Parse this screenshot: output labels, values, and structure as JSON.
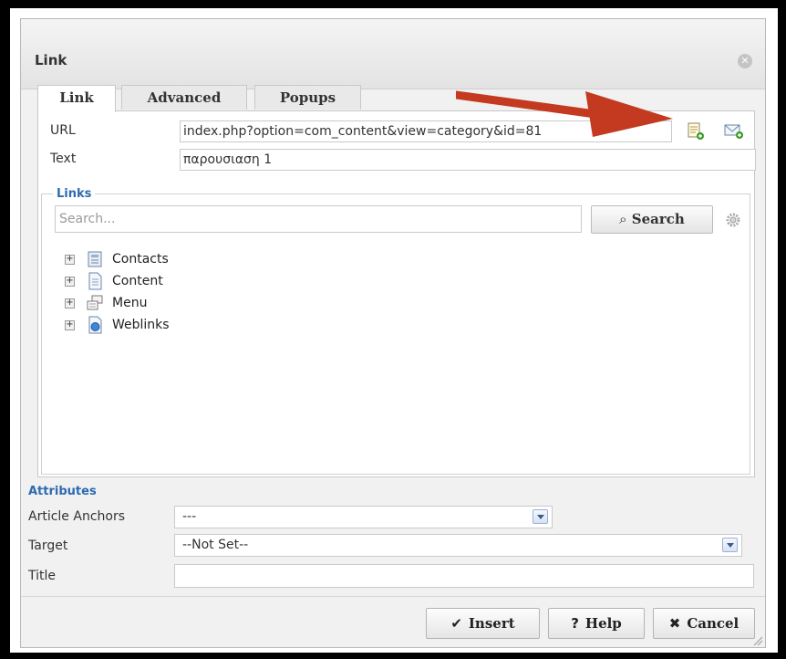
{
  "dialog": {
    "title": "Link"
  },
  "tabs": [
    {
      "label": "Link",
      "active": true
    },
    {
      "label": "Advanced",
      "active": false
    },
    {
      "label": "Popups",
      "active": false
    }
  ],
  "fields": {
    "url_label": "URL",
    "url_value": "index.php?option=com_content&view=category&id=81",
    "text_label": "Text",
    "text_value": "παρουσιαση 1"
  },
  "links": {
    "legend": "Links",
    "search_placeholder": "Search...",
    "search_button": "Search",
    "tree": [
      {
        "label": "Contacts",
        "icon": "contacts-icon"
      },
      {
        "label": "Content",
        "icon": "content-icon"
      },
      {
        "label": "Menu",
        "icon": "menu-icon"
      },
      {
        "label": "Weblinks",
        "icon": "weblinks-icon"
      }
    ]
  },
  "attributes": {
    "title": "Attributes",
    "anchors_label": "Article Anchors",
    "anchors_value": "---",
    "target_label": "Target",
    "target_value": "--Not Set--",
    "title_label": "Title",
    "title_value": ""
  },
  "buttons": {
    "insert": "Insert",
    "help": "Help",
    "cancel": "Cancel"
  },
  "colors": {
    "accent": "#2e6ab1",
    "arrow": "#c43a20",
    "background_frame": "#000000"
  }
}
